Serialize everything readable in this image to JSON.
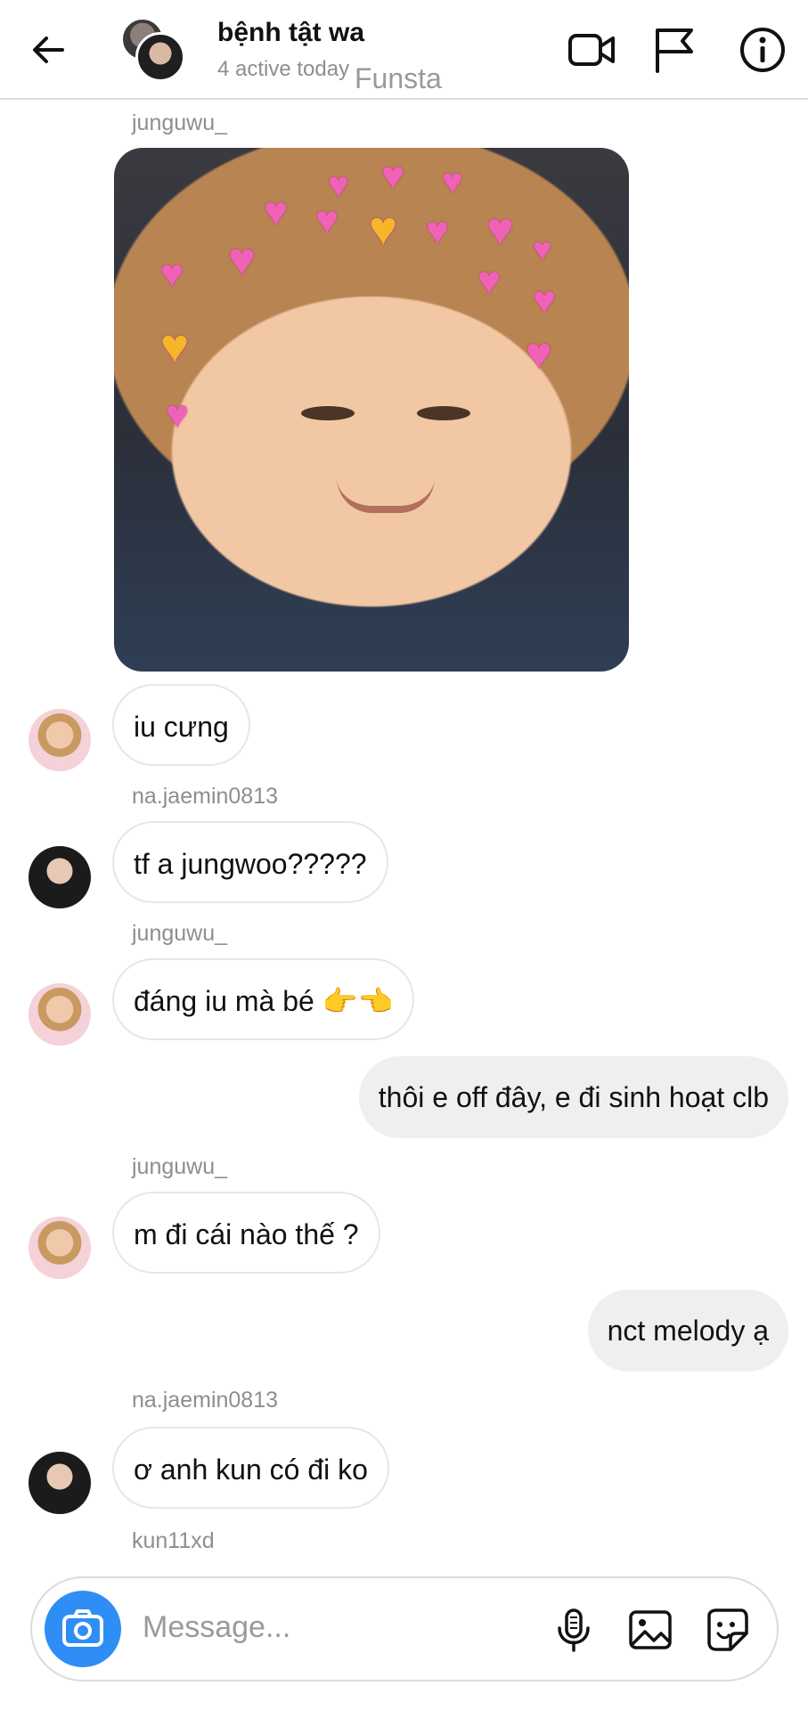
{
  "header": {
    "title": "bệnh tật wa",
    "subtitle": "4 active today",
    "brand": "Funsta"
  },
  "messages": [
    {
      "sender": "junguwu_",
      "type": "image"
    },
    {
      "type": "text",
      "text": "iu cưng",
      "direction": "incoming"
    },
    {
      "sender": "na.jaemin0813",
      "type": "text",
      "text": "tf a jungwoo?????",
      "direction": "incoming"
    },
    {
      "sender": "junguwu_",
      "type": "text",
      "text": "đáng iu mà bé 👉👈",
      "direction": "incoming"
    },
    {
      "type": "text",
      "text": "thôi e off đây, e đi sinh hoạt clb",
      "direction": "outgoing"
    },
    {
      "sender": "junguwu_",
      "type": "text",
      "text": "m đi cái nào thế ?",
      "direction": "incoming"
    },
    {
      "type": "text",
      "text": "nct melody ạ",
      "direction": "outgoing"
    },
    {
      "sender": "na.jaemin0813",
      "type": "text",
      "text": "ơ anh kun có đi ko",
      "direction": "incoming"
    },
    {
      "sender": "kun11xd"
    }
  ],
  "composer": {
    "placeholder": "Message..."
  },
  "icons": {
    "back": "back-arrow-icon",
    "video": "video-call-icon",
    "flag": "flag-icon",
    "info": "info-icon",
    "camera": "camera-icon",
    "mic": "microphone-icon",
    "gallery": "gallery-icon",
    "sticker": "sticker-icon"
  },
  "colors": {
    "accent": "#2f8ef5",
    "outgoing_bubble": "#efefef",
    "meta_text": "#8e8e8e"
  }
}
